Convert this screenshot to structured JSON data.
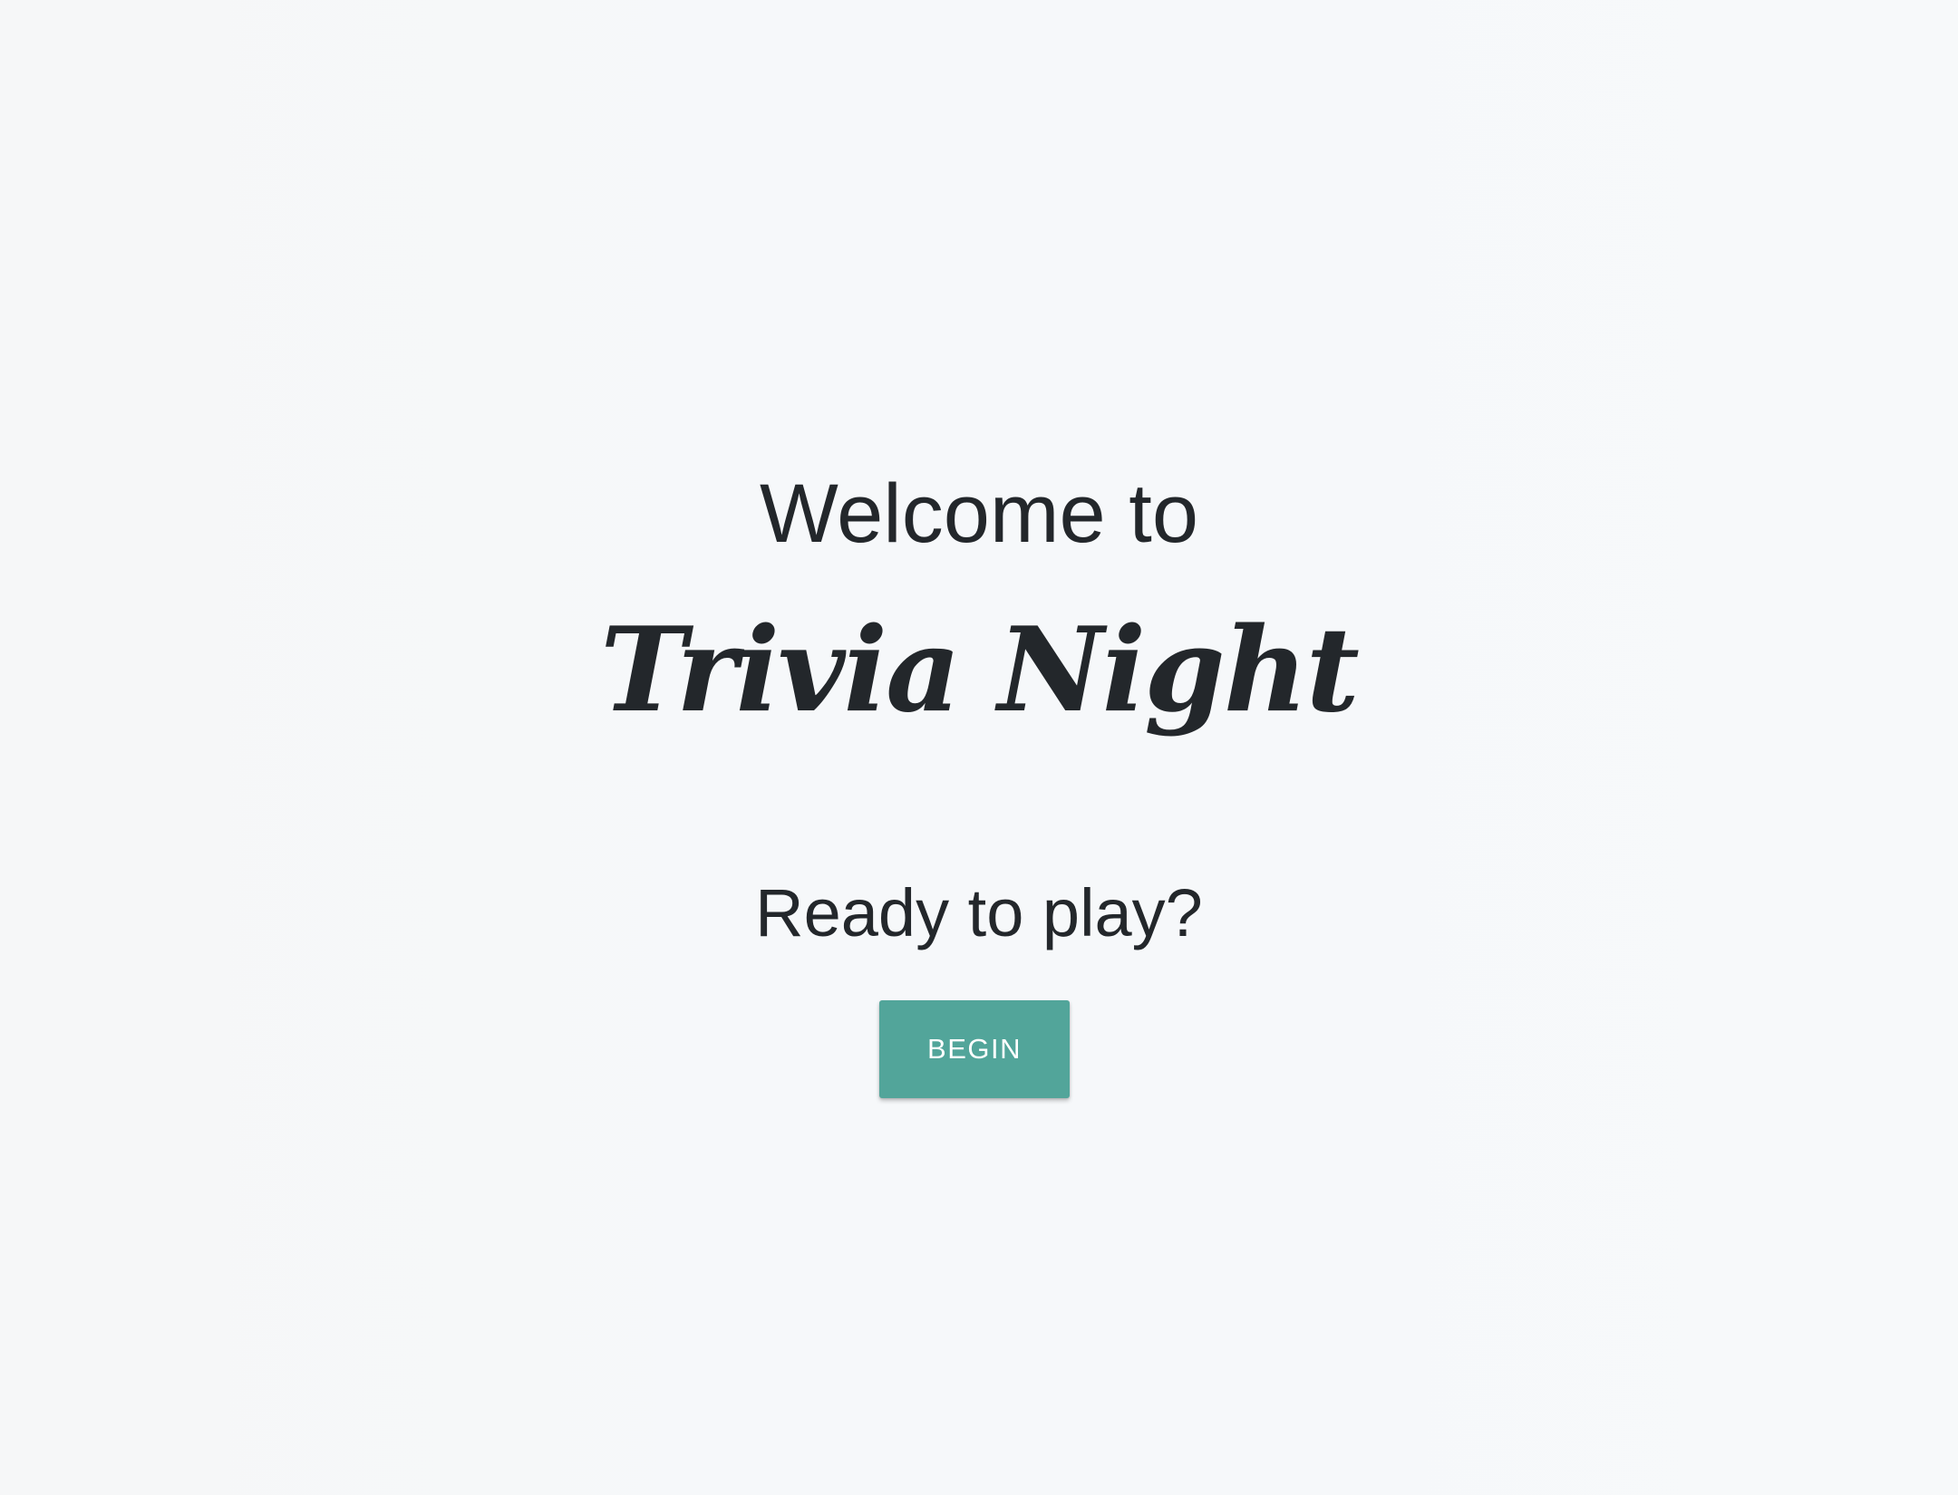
{
  "intro": {
    "welcome_text": "Welcome to",
    "app_title": "Trivia Night",
    "prompt_text": "Ready to play?"
  },
  "actions": {
    "begin_label": "BEGIN"
  },
  "colors": {
    "accent": "#52a59a",
    "text": "#23272b",
    "background": "#f6f8f9"
  }
}
